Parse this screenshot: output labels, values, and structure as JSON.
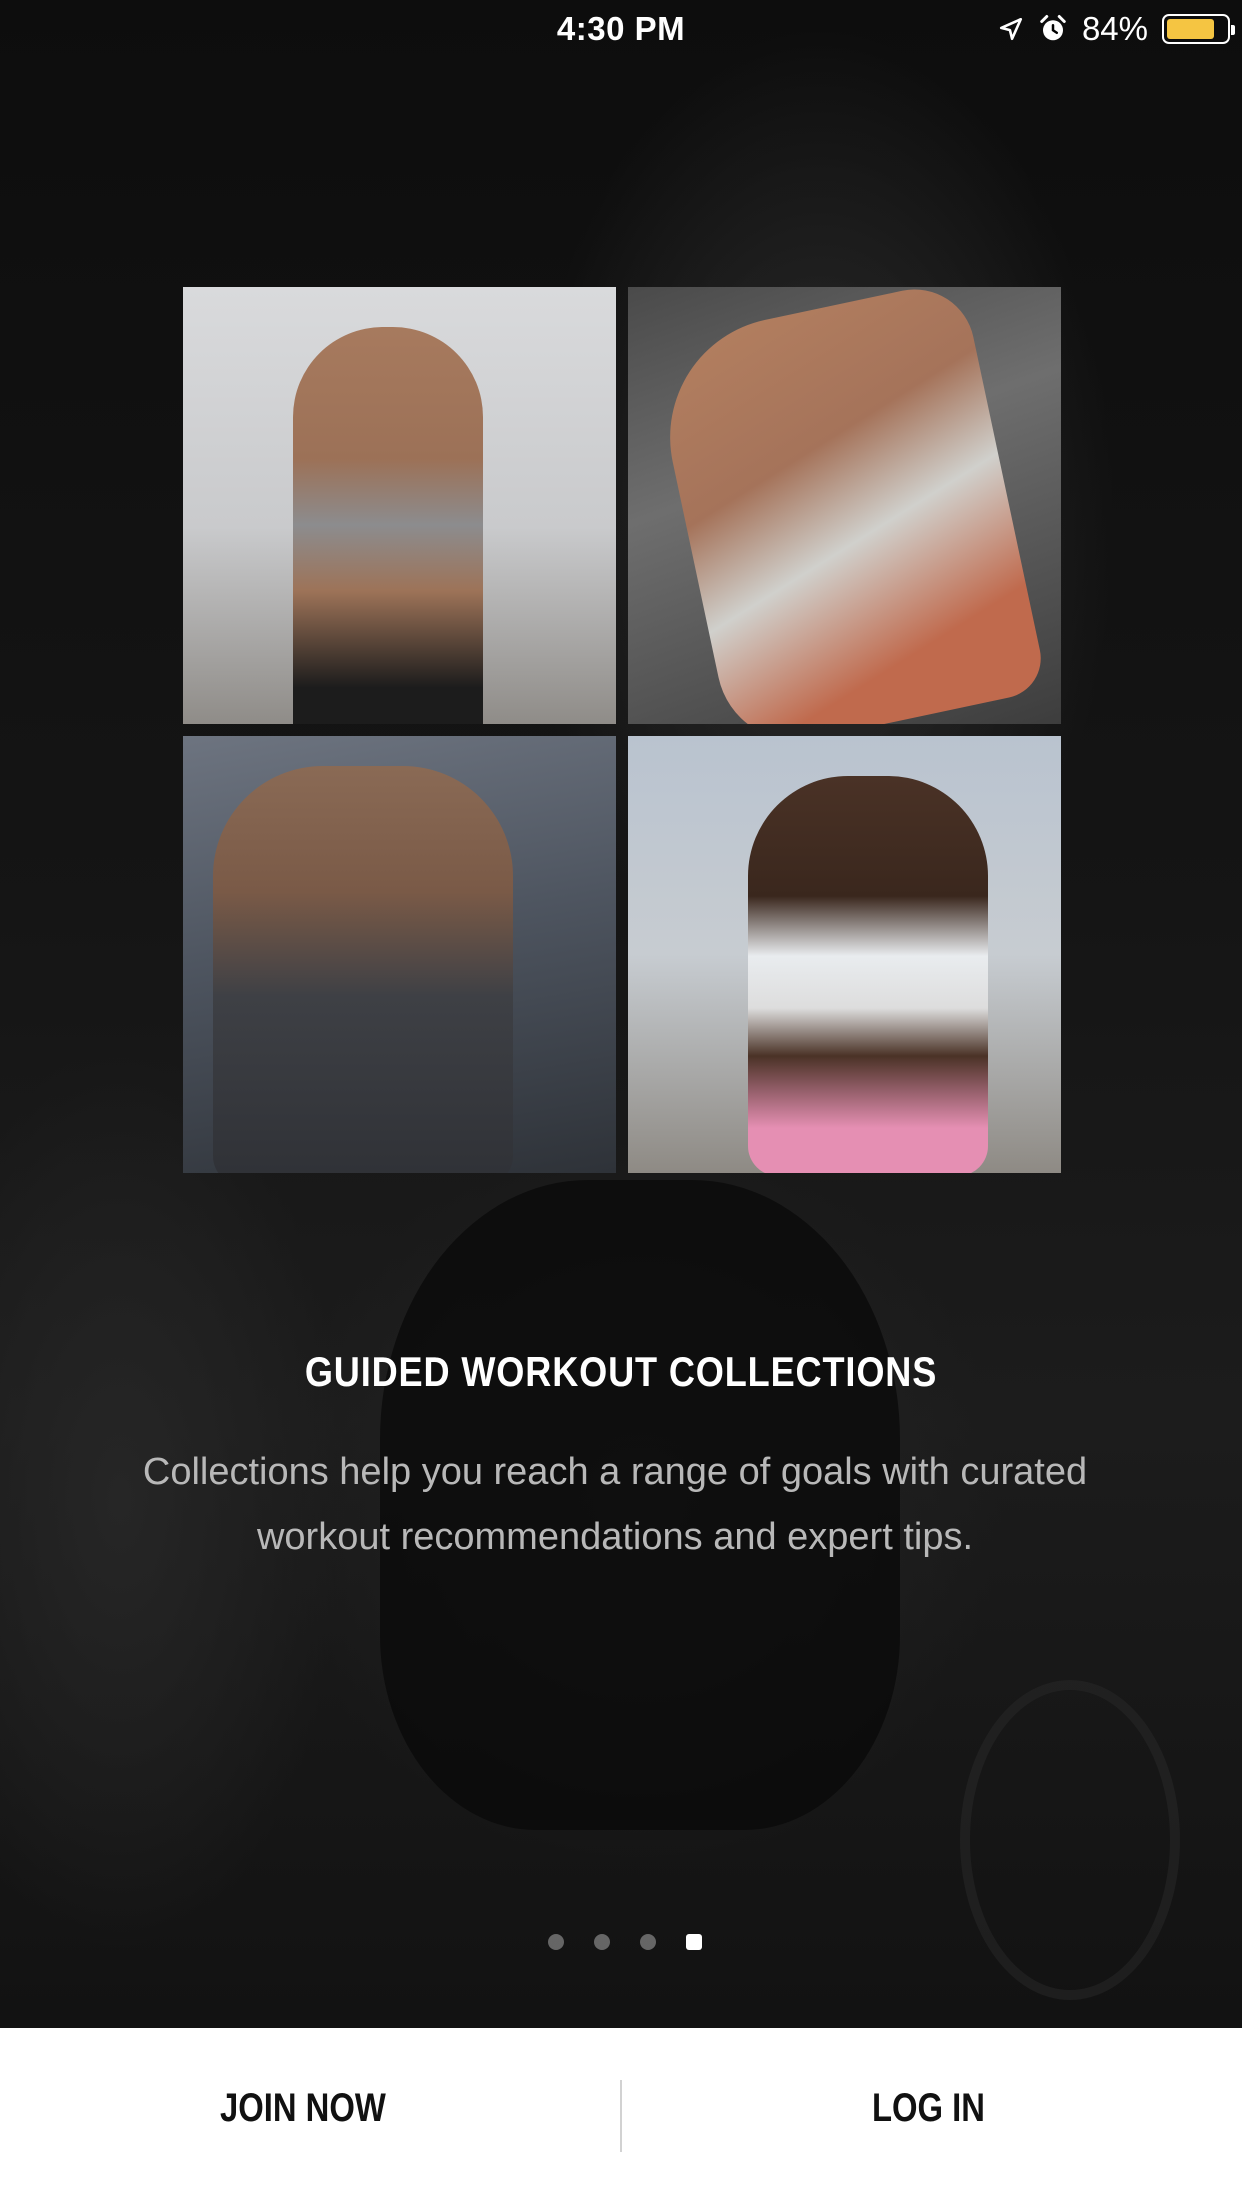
{
  "status_bar": {
    "time": "4:30 PM",
    "battery_percent_label": "84%",
    "battery_level": 0.84,
    "icons": [
      "location-arrow-icon",
      "alarm-clock-icon",
      "battery-icon"
    ]
  },
  "collage": {
    "tiles": [
      "woman-reaching-photo",
      "woman-stretching-photo",
      "man-training-photo",
      "woman-outdoor-photo"
    ]
  },
  "onboarding": {
    "title": "GUIDED WORKOUT COLLECTIONS",
    "description": "Collections help you reach a range of goals with curated workout recommendations and expert tips."
  },
  "page_indicator": {
    "total": 4,
    "current": 4
  },
  "bottom_bar": {
    "join_label": "JOIN NOW",
    "login_label": "LOG IN"
  },
  "colors": {
    "background": "#0b0b0b",
    "bottom_bar": "#ffffff",
    "battery_fill": "#f5c542",
    "text_primary": "#ffffff",
    "text_secondary": "#b8b8b8"
  }
}
